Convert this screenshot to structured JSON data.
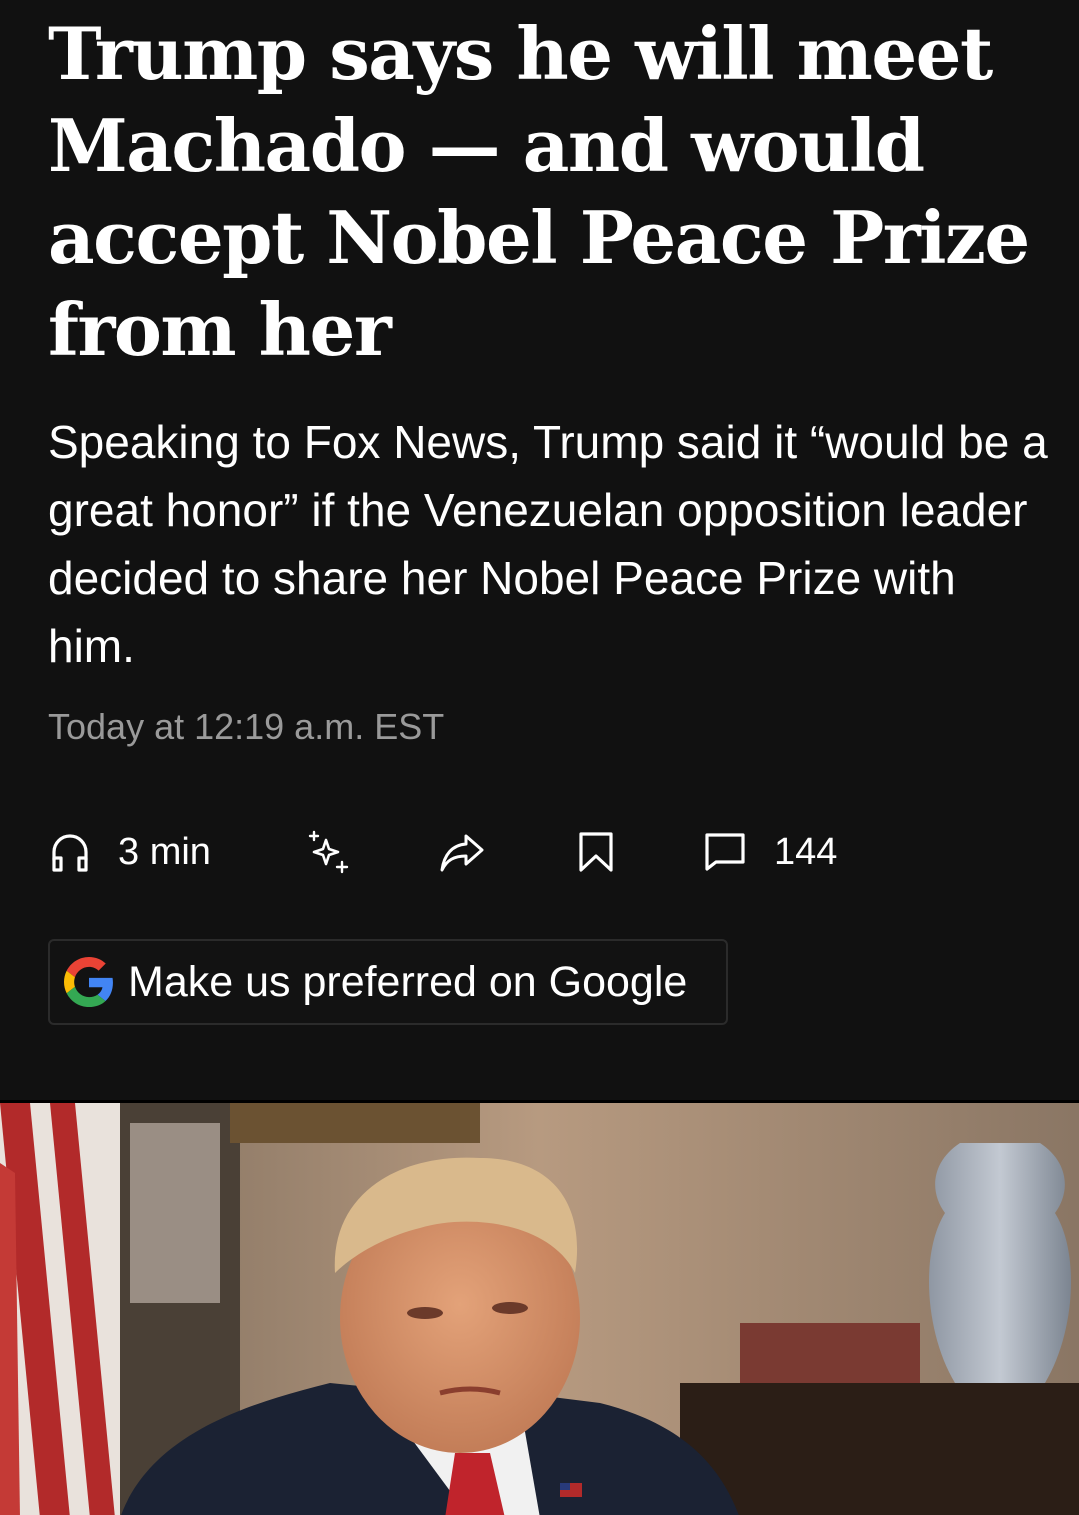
{
  "article": {
    "headline": "Trump says he will meet Machado — and would accept Nobel Peace Prize from her",
    "dek": "Speaking to Fox News, Trump said it “would be a great honor” if the Venezuelan opposition leader decided to share her Nobel Peace Prize with him.",
    "timestamp": "Today at 12:19 a.m. EST"
  },
  "actions": {
    "listen_label": "3 min",
    "comments_count": "144",
    "listen_icon": "headphones-icon",
    "ai_icon": "sparkles-icon",
    "share_icon": "share-arrow-icon",
    "save_icon": "bookmark-icon",
    "comments_icon": "comment-icon"
  },
  "google_cta": {
    "label": "Make us preferred on Google",
    "icon": "google-g-icon"
  },
  "colors": {
    "background": "#111111",
    "text": "#ffffff",
    "muted": "#9a9a9a"
  }
}
